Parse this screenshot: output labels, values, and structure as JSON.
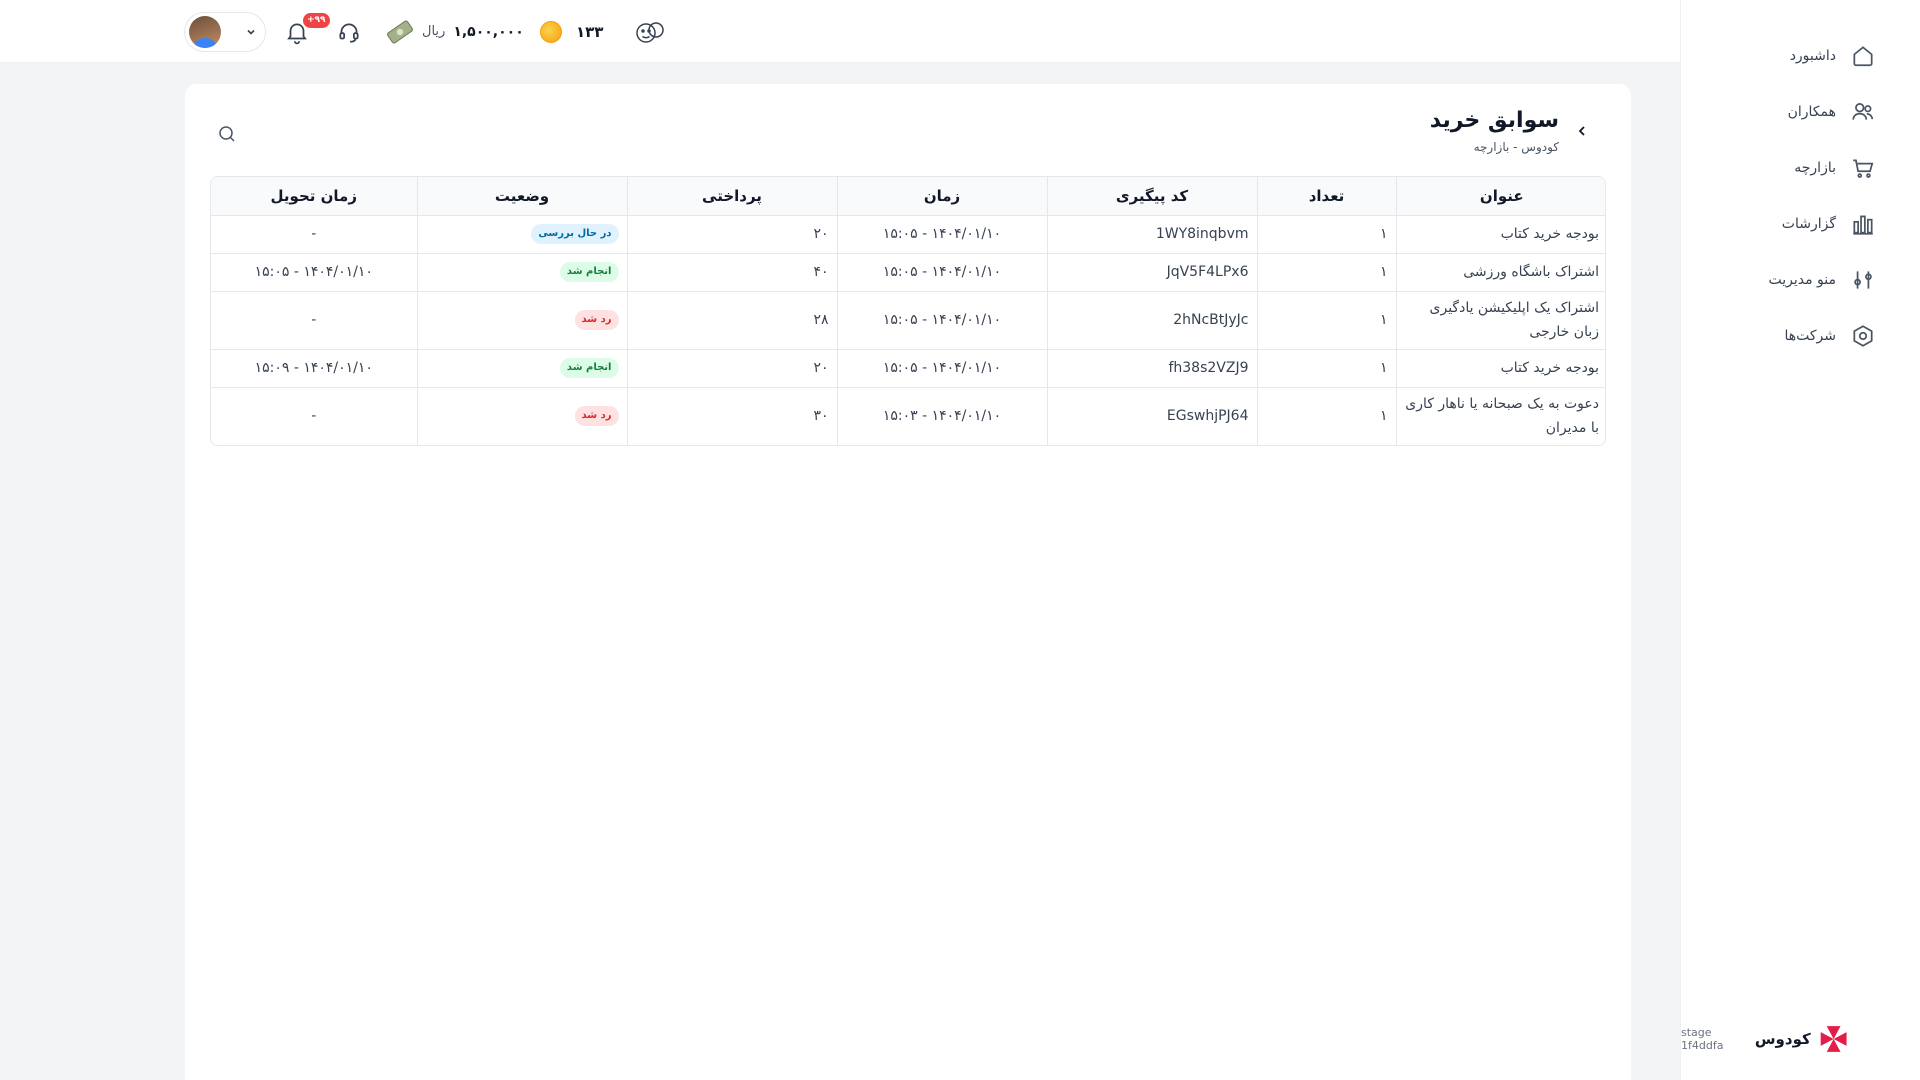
{
  "sidebar": {
    "items": [
      {
        "label": "داشبورد",
        "icon": "home-icon"
      },
      {
        "label": "همکاران",
        "icon": "users-icon"
      },
      {
        "label": "بازارچه",
        "icon": "cart-icon"
      },
      {
        "label": "گزارشات",
        "icon": "chart-icon"
      },
      {
        "label": "منو مدیریت",
        "icon": "sliders-icon"
      },
      {
        "label": "شرکت‌ها",
        "icon": "settings-icon"
      }
    ],
    "brand": {
      "name": "کودوس",
      "stage": "stage 1f4ddfa"
    }
  },
  "header": {
    "notifications_badge": "+۹۹",
    "money_amount": "۱,۵۰۰,۰۰۰",
    "money_unit": "ریال",
    "coins": "۱۳۳"
  },
  "page": {
    "title": "سوابق خرید",
    "breadcrumb": "کودوس - بازارچه"
  },
  "table": {
    "columns": [
      "عنوان",
      "تعداد",
      "کد پیگیری",
      "زمان",
      "پرداختی",
      "وضعیت",
      "زمان تحویل"
    ],
    "rows": [
      {
        "title": "بودجه خرید کتاب",
        "count": "۱",
        "code": "1WY8inqbvm",
        "time": "۱۴۰۴/۰۱/۱۰ - ۱۵:۰۵",
        "paid": "۲۰",
        "status": "در حال بررسی",
        "status_type": "review",
        "delivery": "-"
      },
      {
        "title": "اشتراک باشگاه ورزشی",
        "count": "۱",
        "code": "JqV5F4LPx6",
        "time": "۱۴۰۴/۰۱/۱۰ - ۱۵:۰۵",
        "paid": "۴۰",
        "status": "انجام شد",
        "status_type": "done",
        "delivery": "۱۴۰۴/۰۱/۱۰ - ۱۵:۰۵"
      },
      {
        "title": "اشتراک یک اپلیکیشن یادگیری زبان خارجی",
        "count": "۱",
        "code": "2hNcBtJyJc",
        "time": "۱۴۰۴/۰۱/۱۰ - ۱۵:۰۵",
        "paid": "۲۸",
        "status": "رد شد",
        "status_type": "rejected",
        "delivery": "-"
      },
      {
        "title": "بودجه خرید کتاب",
        "count": "۱",
        "code": "fh38s2VZJ9",
        "time": "۱۴۰۴/۰۱/۱۰ - ۱۵:۰۵",
        "paid": "۲۰",
        "status": "انجام شد",
        "status_type": "done",
        "delivery": "۱۴۰۴/۰۱/۱۰ - ۱۵:۰۹"
      },
      {
        "title": "دعوت به یک صبحانه یا ناهار کاری با مدیران",
        "count": "۱",
        "code": "EGswhjPJ64",
        "time": "۱۴۰۴/۰۱/۱۰ - ۱۵:۰۳",
        "paid": "۳۰",
        "status": "رد شد",
        "status_type": "rejected",
        "delivery": "-"
      }
    ]
  },
  "colors": {
    "review": "#0369a1",
    "done": "#15803d",
    "rejected": "#dc2626",
    "badge": "#ef4444",
    "brand": "#e11d48"
  }
}
